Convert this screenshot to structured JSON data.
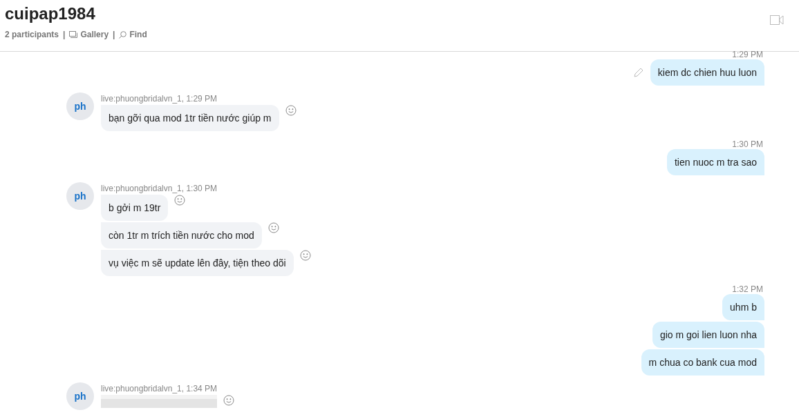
{
  "header": {
    "title": "cuipap1984",
    "participants": "2 participants",
    "separator": "|",
    "gallery": "Gallery",
    "find": "Find"
  },
  "groups": [
    {
      "kind": "outgoing",
      "time": "1:29 PM",
      "messages": [
        {
          "kind": "text",
          "text": "kiem dc chien huu luon",
          "edited": true
        }
      ]
    },
    {
      "kind": "incoming",
      "avatar": "ph",
      "meta": "live:phuongbridalvn_1, 1:29 PM",
      "messages": [
        {
          "kind": "text",
          "text": "bạn gỡi qua mod 1tr tiền nước giúp m"
        }
      ]
    },
    {
      "kind": "outgoing",
      "time": "1:30 PM",
      "messages": [
        {
          "kind": "text",
          "text": "tien nuoc m tra sao",
          "edited": false
        }
      ]
    },
    {
      "kind": "incoming",
      "avatar": "ph",
      "meta": "live:phuongbridalvn_1, 1:30 PM",
      "messages": [
        {
          "kind": "text",
          "text": "b gởi m 19tr"
        },
        {
          "kind": "text",
          "text": "còn 1tr m trích tiền nước cho mod"
        },
        {
          "kind": "text",
          "text": "vụ việc m sẽ update lên đây, tiện theo dõi"
        }
      ]
    },
    {
      "kind": "outgoing",
      "time": "1:32 PM",
      "messages": [
        {
          "kind": "text",
          "text": "uhm b",
          "edited": false
        },
        {
          "kind": "text",
          "text": "gio m goi lien luon nha",
          "edited": false
        },
        {
          "kind": "text",
          "text": "m chua co bank cua mod",
          "edited": false
        }
      ]
    },
    {
      "kind": "incoming",
      "avatar": "ph",
      "meta": "live:phuongbridalvn_1, 1:34 PM",
      "messages": [
        {
          "kind": "image"
        }
      ]
    }
  ]
}
